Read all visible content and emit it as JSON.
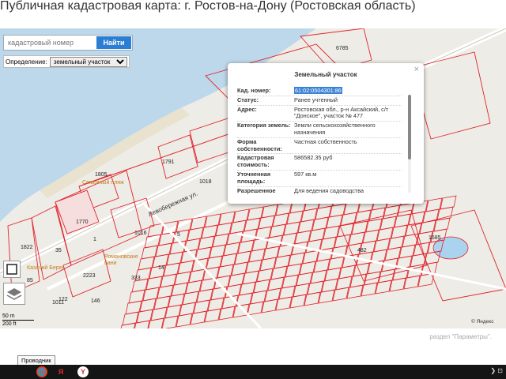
{
  "page": {
    "title": "Публичная кадастровая карта: г. Ростов-на-Дону (Ростовская область)"
  },
  "search": {
    "placeholder": "кадастровый номер",
    "button_label": "Найти"
  },
  "definition": {
    "label": "Определение:",
    "selected": "земельный участок"
  },
  "popup": {
    "title": "Земельный участок",
    "close_label": "×",
    "rows": [
      {
        "key": "Кад. номер:",
        "value": "61:02:0504301:86"
      },
      {
        "key": "Статус:",
        "value": "Ранее учтенный"
      },
      {
        "key": "Адрес:",
        "value": "Ростовская обл., р-н Аксайский, с/т \"Донское\", участок № 477"
      },
      {
        "key": "Категория земель:",
        "value": "Земли сельскохозяйственного назначения"
      },
      {
        "key": "Форма собственности:",
        "value": "Частная собственность"
      },
      {
        "key": "Кадастровая стоимость:",
        "value": "586582.35 руб"
      },
      {
        "key": "Уточненная площадь:",
        "value": "597 кв.м"
      },
      {
        "key": "Разрешенное",
        "value": "Для ведения садоводства"
      }
    ]
  },
  "map": {
    "labels": {
      "street": "Левобережная ул.",
      "beach": "Семейный пляж",
      "baths": "Романовские бани",
      "cafe": "Казачий Берег",
      "stamp": "© Яндекс"
    },
    "numbers": [
      "6785",
      "1791",
      "1018",
      "1770",
      "1016",
      "1822",
      "1011",
      "2223",
      "1585",
      "482",
      "1805",
      "333",
      "5",
      "14",
      "122",
      "146",
      "1",
      "35",
      "85"
    ],
    "colors": {
      "water": "#bdd8ea",
      "land": "#eeece6",
      "parcel": "#e0242c",
      "road": "#ffffff",
      "pond": "#aad3f0",
      "parcel_fill": "#f6dede"
    }
  },
  "scale": {
    "top": "50 m",
    "bottom": "200 ft"
  },
  "settings_note": "раздел \"Параметры\".",
  "tooltip": "Проводник",
  "taskbar": {
    "icons": [
      "yandex-browser-icon",
      "yandex-icon",
      "y-icon"
    ],
    "tray": "❯ ⊡"
  }
}
